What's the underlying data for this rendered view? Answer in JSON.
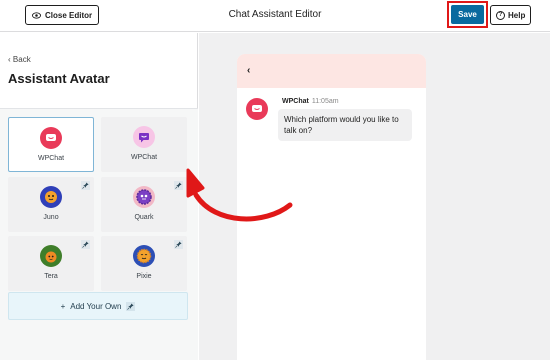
{
  "header": {
    "close_label": "Close Editor",
    "title": "Chat Assistant Editor",
    "save_label": "Save",
    "help_label": "Help"
  },
  "sidebar": {
    "back_label": "Back",
    "title": "Assistant Avatar",
    "avatars": [
      {
        "name": "WPChat",
        "color": "#e93a59",
        "pinned": false,
        "selected": true
      },
      {
        "name": "WPChat",
        "color": "#f7c5e6",
        "pinned": false,
        "selected": false
      },
      {
        "name": "Juno",
        "color": "#2f3fb8",
        "pinned": true,
        "selected": false
      },
      {
        "name": "Quark",
        "color": "#7b3fc4",
        "pinned": true,
        "selected": false
      },
      {
        "name": "Tera",
        "color": "#3f7e2a",
        "pinned": true,
        "selected": false
      },
      {
        "name": "Pixie",
        "color": "#2d4fb5",
        "pinned": true,
        "selected": false
      }
    ],
    "add_own_label": "Add Your Own"
  },
  "preview": {
    "sender": "WPChat",
    "time": "11:05am",
    "message": "Which platform would you like to talk on?"
  },
  "colors": {
    "accent": "#0a6a9f",
    "highlight": "#e01818",
    "brand": "#e93a59"
  }
}
